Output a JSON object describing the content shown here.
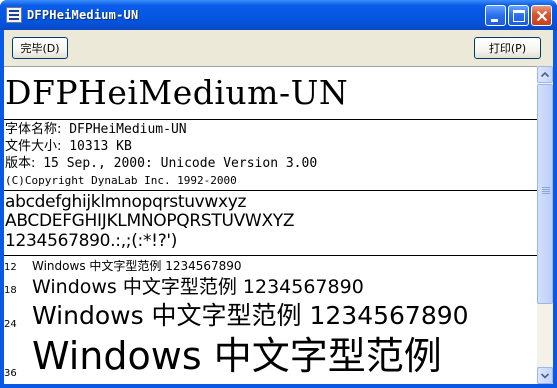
{
  "window": {
    "title": "DFPHeiMedium-UN"
  },
  "toolbar": {
    "done_label": "完毕(D)",
    "print_label": "打印(P)"
  },
  "font_preview": {
    "font_name": "DFPHeiMedium-UN",
    "info": {
      "typeface_label": "字体名称:",
      "typeface_value": "DFPHeiMedium-UN",
      "filesize_label": "文件大小:",
      "filesize_value": "10313 KB",
      "version_label": "版本:",
      "version_value": "15 Sep., 2000: Unicode Version 3.00",
      "copyright": "(C)Copyright DynaLab Inc. 1992-2000"
    },
    "charset": {
      "lowercase": "abcdefghijklmnopqrstuvwxyz",
      "uppercase": "ABCDEFGHIJKLMNOPQRSTUVWXYZ",
      "digits": "1234567890.:,;(:*!?')"
    },
    "samples": [
      {
        "size": "12",
        "text": "Windows 中文字型范例 1234567890"
      },
      {
        "size": "18",
        "text": "Windows 中文字型范例 1234567890"
      },
      {
        "size": "24",
        "text": "Windows 中文字型范例 1234567890"
      },
      {
        "size": "36",
        "text": "Windows 中文字型范例"
      }
    ]
  }
}
